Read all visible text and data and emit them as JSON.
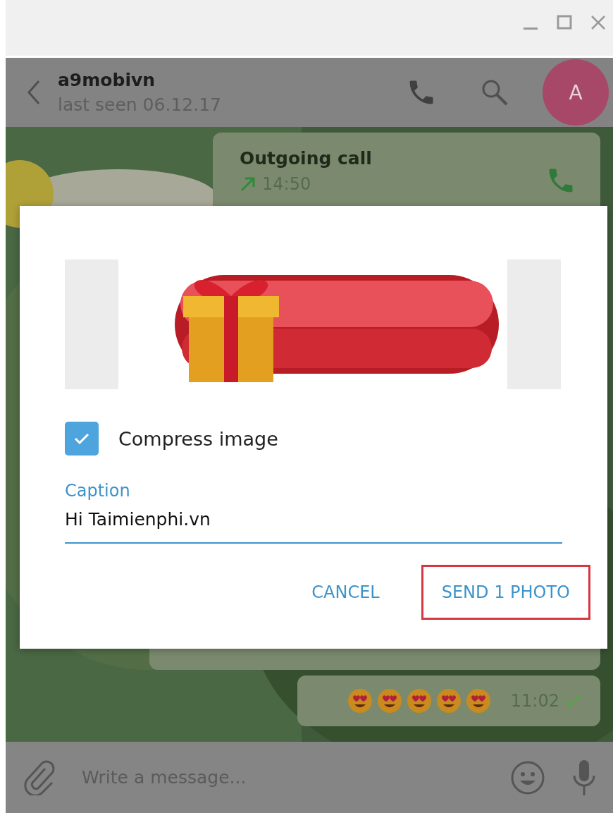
{
  "header": {
    "name": "a9mobivn",
    "status": "last seen 06.12.17",
    "avatar": "A"
  },
  "messages": [
    {
      "kind": "call",
      "title": "Outgoing call",
      "time": "14:50"
    },
    {
      "kind": "hidden"
    },
    {
      "kind": "emoji",
      "emojis": [
        {
          "kind": "heart-eyes"
        },
        {
          "kind": "heart-eyes"
        },
        {
          "kind": "heart-eyes"
        },
        {
          "kind": "heart-eyes"
        },
        {
          "kind": "heart-eyes"
        }
      ],
      "time": "11:02",
      "read": true
    }
  ],
  "dialog": {
    "compress": {
      "label": "Compress image",
      "checked": true
    },
    "caption": {
      "label": "Caption",
      "value": "Hi Taimienphi.vn"
    },
    "buttons": [
      {
        "label": "CANCEL",
        "highlighted": false
      },
      {
        "label": "SEND 1 PHOTO",
        "highlighted": true
      }
    ]
  },
  "composer": {
    "placeholder": "Write a message..."
  }
}
